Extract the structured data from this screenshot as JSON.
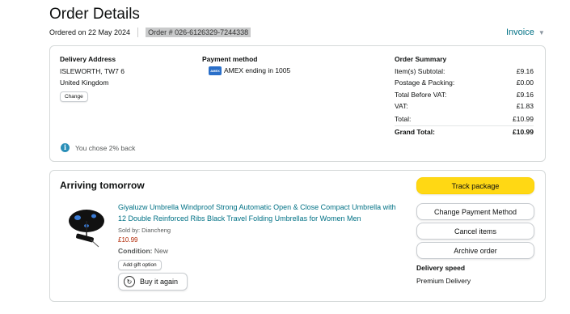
{
  "header": {
    "title": "Order Details",
    "ordered_on": "Ordered on 22 May 2024",
    "order_number": "Order # 026-6126329-7244338",
    "invoice_label": "Invoice"
  },
  "delivery_address": {
    "heading": "Delivery Address",
    "line1": "ISLEWORTH, TW7 6",
    "line2": "United Kingdom",
    "change_label": "Change"
  },
  "payment": {
    "heading": "Payment method",
    "card_icon": "amex-card-icon",
    "card_text": "AMEX ending in 1005"
  },
  "summary": {
    "heading": "Order Summary",
    "rows": [
      {
        "label": "Item(s) Subtotal:",
        "value": "£9.16"
      },
      {
        "label": "Postage & Packing:",
        "value": "£0.00"
      },
      {
        "label": "Total Before VAT:",
        "value": "£9.16"
      },
      {
        "label": "VAT:",
        "value": "£1.83"
      },
      {
        "label": "Total:",
        "value": "£10.99"
      },
      {
        "label": "Grand Total:",
        "value": "£10.99"
      }
    ]
  },
  "cashback": {
    "icon": "info-icon",
    "text": "You chose 2% back"
  },
  "shipment": {
    "status": "Arriving tomorrow",
    "product_title": "Giyaluzw Umbrella Windproof Strong Automatic Open & Close Compact Umbrella with 12 Double Reinforced Ribs Black Travel Folding Umbrellas for Women Men",
    "sold_by": "Sold by: Diancheng",
    "price": "£10.99",
    "condition_label": "Condition:",
    "condition_value": "New",
    "gift_option_label": "Add gift option",
    "buy_again_label": "Buy it again",
    "buttons": {
      "track": "Track package",
      "change_payment": "Change Payment Method",
      "cancel": "Cancel items",
      "archive": "Archive order"
    },
    "delivery_speed_heading": "Delivery speed",
    "delivery_speed_value": "Premium Delivery"
  },
  "colors": {
    "link": "#007185",
    "price": "#b12704",
    "primary_button": "#ffd814",
    "info": "#2a8fb8"
  }
}
